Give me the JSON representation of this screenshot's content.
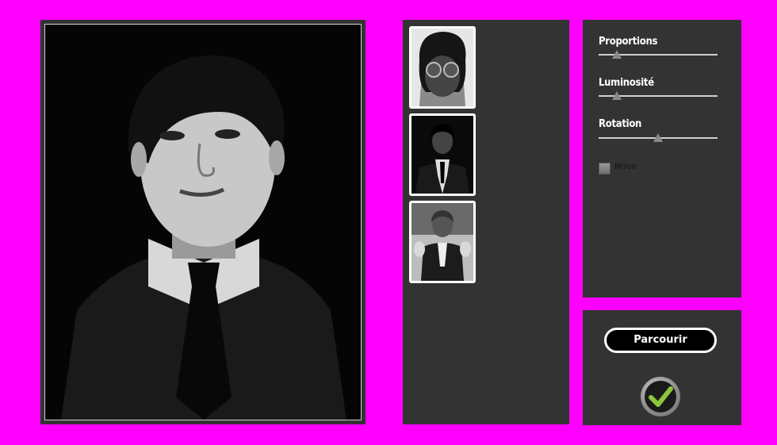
{
  "controls": {
    "proportions_label": "Proportions",
    "proportions_value": 0.15,
    "luminosity_label": "Luminosité",
    "luminosity_value": 0.15,
    "rotation_label": "Rotation",
    "rotation_value": 0.5,
    "mirror_label": "Miroir",
    "mirror_checked": false
  },
  "actions": {
    "browse_label": "Parcourir",
    "confirm_icon": "checkmark-icon"
  },
  "thumbnails": [
    {
      "name": "template-round-glasses"
    },
    {
      "name": "template-suit-tie"
    },
    {
      "name": "template-thumbs-up"
    }
  ],
  "colors": {
    "background": "#ff00ff",
    "panel": "#333333",
    "check_green": "#8cc63f"
  }
}
